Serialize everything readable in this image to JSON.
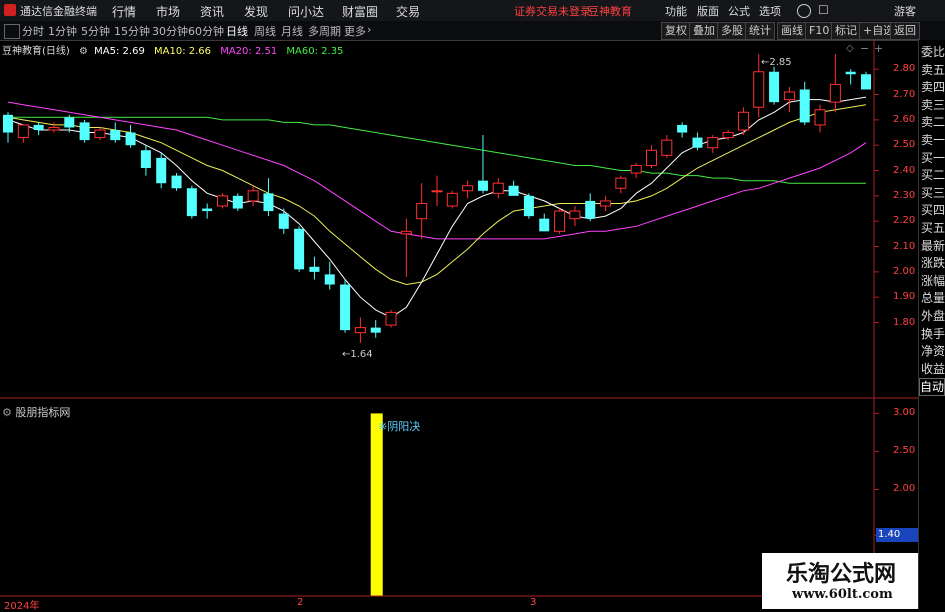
{
  "titlebar": {
    "app_name": "通达信金融终端",
    "menu": [
      "行情",
      "市场",
      "资讯",
      "发现",
      "问小达",
      "财富圈",
      "交易"
    ],
    "notice": "证券交易未登录",
    "stock_name": "豆神教育",
    "right": [
      "功能",
      "版面",
      "公式",
      "选项"
    ],
    "guest": "游客"
  },
  "tabbar": {
    "periods": [
      "分时",
      "1分钟",
      "5分钟",
      "15分钟",
      "30分钟",
      "60分钟",
      "日线",
      "周线",
      "月线",
      "多周期",
      "更多"
    ],
    "active": "日线",
    "right_buttons": [
      "复权",
      "叠加",
      "多股",
      "统计",
      "画线",
      "F10",
      "标记",
      "+自选",
      "返回"
    ]
  },
  "chart_info": {
    "title": "豆神教育(日线)",
    "ma": [
      {
        "label": "MA5: 2.69",
        "color": "#ffffff"
      },
      {
        "label": "MA10: 2.66",
        "color": "#ffff66"
      },
      {
        "label": "MA20: 2.51",
        "color": "#ff44ff"
      },
      {
        "label": "MA60: 2.35",
        "color": "#44ee44"
      }
    ]
  },
  "sidepanel": [
    "委比",
    "卖五",
    "卖四",
    "卖三",
    "卖二",
    "卖一",
    "买一",
    "买二",
    "买三",
    "买四",
    "买五",
    "最新",
    "涨跌",
    "涨幅",
    "总量",
    "外盘",
    "换手",
    "净资",
    "收益",
    "自动"
  ],
  "y_axis": [
    "2.80",
    "2.70",
    "2.60",
    "2.50",
    "2.40",
    "2.30",
    "2.20",
    "2.10",
    "2.00",
    "1.90",
    "1.80"
  ],
  "sub_axis": [
    "3.00",
    "2.50",
    "2.00",
    "1.40",
    "1.00"
  ],
  "sub_current": "1.40",
  "x_axis": [
    "2024年",
    "2",
    "3"
  ],
  "annotations": {
    "high": "2.85",
    "low": "1.64",
    "signal": "阴阳决"
  },
  "sub_title": "股朋指标网",
  "watermark": {
    "title": "乐淘公式网",
    "url": "www.60lt.com"
  },
  "chart_data": {
    "type": "candlestick",
    "series_candles": [
      [
        2.62,
        2.63,
        2.51,
        2.55
      ],
      [
        2.53,
        2.58,
        2.51,
        2.58
      ],
      [
        2.58,
        2.59,
        2.54,
        2.56
      ],
      [
        2.56,
        2.59,
        2.55,
        2.57
      ],
      [
        2.61,
        2.62,
        2.55,
        2.57
      ],
      [
        2.59,
        2.6,
        2.51,
        2.52
      ],
      [
        2.53,
        2.57,
        2.52,
        2.56
      ],
      [
        2.56,
        2.59,
        2.51,
        2.52
      ],
      [
        2.55,
        2.58,
        2.49,
        2.5
      ],
      [
        2.48,
        2.5,
        2.38,
        2.41
      ],
      [
        2.45,
        2.47,
        2.33,
        2.35
      ],
      [
        2.38,
        2.39,
        2.32,
        2.33
      ],
      [
        2.33,
        2.34,
        2.21,
        2.22
      ],
      [
        2.25,
        2.27,
        2.21,
        2.24
      ],
      [
        2.26,
        2.31,
        2.25,
        2.3
      ],
      [
        2.3,
        2.31,
        2.24,
        2.25
      ],
      [
        2.28,
        2.34,
        2.26,
        2.32
      ],
      [
        2.31,
        2.37,
        2.22,
        2.24
      ],
      [
        2.23,
        2.25,
        2.15,
        2.17
      ],
      [
        2.17,
        2.18,
        2.0,
        2.01
      ],
      [
        2.02,
        2.06,
        1.97,
        2.0
      ],
      [
        1.99,
        2.04,
        1.93,
        1.95
      ],
      [
        1.95,
        1.97,
        1.76,
        1.77
      ],
      [
        1.76,
        1.82,
        1.72,
        1.78
      ],
      [
        1.78,
        1.81,
        1.74,
        1.76
      ],
      [
        1.79,
        1.85,
        1.78,
        1.84
      ],
      [
        2.15,
        2.21,
        1.98,
        2.16
      ],
      [
        2.21,
        2.35,
        2.13,
        2.27
      ],
      [
        2.32,
        2.38,
        2.26,
        2.32
      ],
      [
        2.26,
        2.32,
        2.25,
        2.31
      ],
      [
        2.32,
        2.36,
        2.29,
        2.34
      ],
      [
        2.36,
        2.54,
        2.31,
        2.32
      ],
      [
        2.31,
        2.37,
        2.29,
        2.35
      ],
      [
        2.34,
        2.36,
        2.31,
        2.3
      ],
      [
        2.3,
        2.31,
        2.21,
        2.22
      ],
      [
        2.21,
        2.23,
        2.16,
        2.16
      ],
      [
        2.16,
        2.25,
        2.15,
        2.24
      ],
      [
        2.21,
        2.26,
        2.18,
        2.24
      ],
      [
        2.28,
        2.31,
        2.2,
        2.21
      ],
      [
        2.26,
        2.3,
        2.24,
        2.28
      ],
      [
        2.33,
        2.38,
        2.31,
        2.37
      ],
      [
        2.39,
        2.43,
        2.37,
        2.42
      ],
      [
        2.42,
        2.5,
        2.41,
        2.48
      ],
      [
        2.46,
        2.54,
        2.45,
        2.52
      ],
      [
        2.58,
        2.59,
        2.53,
        2.55
      ],
      [
        2.53,
        2.55,
        2.48,
        2.49
      ],
      [
        2.49,
        2.54,
        2.47,
        2.53
      ],
      [
        2.53,
        2.56,
        2.52,
        2.55
      ],
      [
        2.56,
        2.65,
        2.54,
        2.63
      ],
      [
        2.65,
        2.86,
        2.61,
        2.79
      ],
      [
        2.79,
        2.81,
        2.66,
        2.67
      ],
      [
        2.68,
        2.73,
        2.63,
        2.71
      ],
      [
        2.72,
        2.75,
        2.58,
        2.59
      ],
      [
        2.58,
        2.66,
        2.55,
        2.64
      ],
      [
        2.67,
        2.86,
        2.63,
        2.74
      ],
      [
        2.79,
        2.8,
        2.74,
        2.78
      ],
      [
        2.78,
        2.79,
        2.72,
        2.72
      ]
    ],
    "ma5": [
      2.6,
      2.58,
      2.56,
      2.56,
      2.56,
      2.55,
      2.55,
      2.54,
      2.53,
      2.5,
      2.47,
      2.42,
      2.36,
      2.31,
      2.29,
      2.27,
      2.28,
      2.27,
      2.24,
      2.19,
      2.12,
      2.05,
      1.97,
      1.9,
      1.85,
      1.82,
      1.86,
      1.96,
      2.07,
      2.18,
      2.27,
      2.3,
      2.32,
      2.32,
      2.3,
      2.28,
      2.25,
      2.22,
      2.21,
      2.22,
      2.25,
      2.31,
      2.35,
      2.41,
      2.47,
      2.5,
      2.52,
      2.53,
      2.55,
      2.6,
      2.63,
      2.67,
      2.68,
      2.68,
      2.67,
      2.68,
      2.69
    ],
    "ma10": [
      2.61,
      2.6,
      2.59,
      2.58,
      2.58,
      2.57,
      2.57,
      2.56,
      2.55,
      2.53,
      2.51,
      2.48,
      2.45,
      2.42,
      2.4,
      2.37,
      2.34,
      2.31,
      2.29,
      2.26,
      2.22,
      2.16,
      2.11,
      2.06,
      2.01,
      1.97,
      1.95,
      1.96,
      1.99,
      2.04,
      2.09,
      2.15,
      2.2,
      2.24,
      2.25,
      2.26,
      2.27,
      2.27,
      2.27,
      2.27,
      2.27,
      2.28,
      2.3,
      2.33,
      2.37,
      2.41,
      2.44,
      2.47,
      2.5,
      2.53,
      2.56,
      2.59,
      2.61,
      2.63,
      2.64,
      2.65,
      2.66
    ],
    "ma20": [
      2.67,
      2.66,
      2.65,
      2.64,
      2.63,
      2.62,
      2.61,
      2.6,
      2.59,
      2.58,
      2.57,
      2.56,
      2.54,
      2.52,
      2.5,
      2.48,
      2.46,
      2.44,
      2.42,
      2.39,
      2.36,
      2.32,
      2.28,
      2.24,
      2.2,
      2.16,
      2.15,
      2.14,
      2.13,
      2.13,
      2.13,
      2.13,
      2.13,
      2.13,
      2.13,
      2.13,
      2.14,
      2.15,
      2.16,
      2.16,
      2.17,
      2.18,
      2.2,
      2.22,
      2.24,
      2.26,
      2.28,
      2.3,
      2.32,
      2.33,
      2.35,
      2.37,
      2.39,
      2.41,
      2.44,
      2.47,
      2.51
    ],
    "ma60": [
      2.61,
      2.61,
      2.61,
      2.61,
      2.61,
      2.61,
      2.61,
      2.61,
      2.61,
      2.61,
      2.61,
      2.61,
      2.61,
      2.61,
      2.6,
      2.6,
      2.6,
      2.6,
      2.59,
      2.59,
      2.58,
      2.58,
      2.57,
      2.56,
      2.55,
      2.54,
      2.53,
      2.52,
      2.51,
      2.5,
      2.49,
      2.48,
      2.47,
      2.46,
      2.45,
      2.44,
      2.43,
      2.42,
      2.42,
      2.41,
      2.4,
      2.4,
      2.39,
      2.39,
      2.38,
      2.38,
      2.37,
      2.37,
      2.36,
      2.36,
      2.36,
      2.35,
      2.35,
      2.35,
      2.35,
      2.35,
      2.35
    ],
    "y_range": [
      1.66,
      2.86
    ],
    "sub_signal_index": 24,
    "sub_range": [
      0.6,
      3.15
    ]
  }
}
